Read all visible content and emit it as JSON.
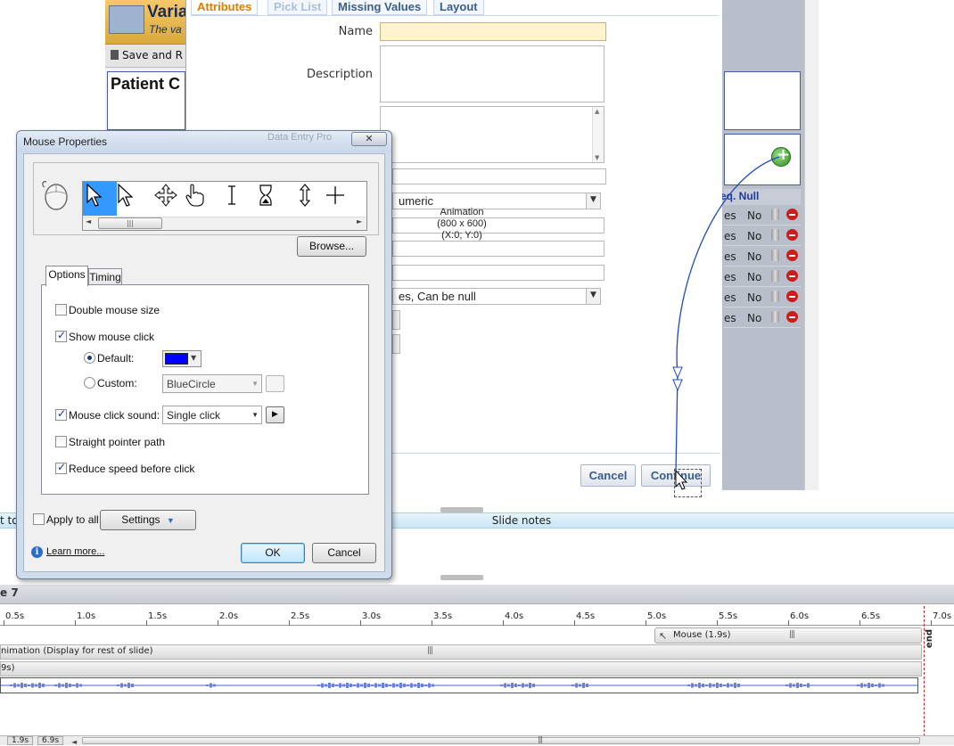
{
  "background_app": {
    "title": "Varia",
    "subtitle": "The va",
    "toolbar_save": "Save and R",
    "section_title": "Patient C",
    "right_table_header": "eq. Null",
    "rows": [
      {
        "a": "es",
        "b": "No"
      },
      {
        "a": "es",
        "b": "No"
      },
      {
        "a": "es",
        "b": "No"
      },
      {
        "a": "es",
        "b": "No"
      },
      {
        "a": "es",
        "b": "No"
      },
      {
        "a": "es",
        "b": "No"
      }
    ]
  },
  "variable_dialog": {
    "tabs": [
      "Attributes",
      "Pick List",
      "Missing Values",
      "Layout"
    ],
    "name_label": "Name",
    "name_value": "",
    "description_label": "Description",
    "description_value": "",
    "type_value": "umeric",
    "nullable_value": "es, Can be null",
    "animation_overlay": [
      "Animation",
      "(800 x 600)",
      "(X:0; Y:0)"
    ],
    "cancel_label": "Cancel",
    "continue_label": "Continue"
  },
  "mouse_properties": {
    "title": "Mouse Properties",
    "title_ghost": "Data Entry Pro",
    "close_glyph": "✕",
    "browse_label": "Browse...",
    "tabs": [
      "Options",
      "Timing"
    ],
    "options": {
      "double_mouse_size": {
        "label": "Double mouse size",
        "checked": false
      },
      "show_mouse_click": {
        "label": "Show mouse click",
        "checked": true
      },
      "default_label": "Default:",
      "default_selected": true,
      "default_color": "#0000ff",
      "custom_label": "Custom:",
      "custom_value": "BlueCircle",
      "mouse_click_sound": {
        "label": "Mouse click sound:",
        "checked": true
      },
      "sound_value": "Single click",
      "straight_pointer_path": {
        "label": "Straight pointer path",
        "checked": false
      },
      "reduce_speed": {
        "label": "Reduce speed before click",
        "checked": true
      }
    },
    "apply_to_all": {
      "label": "Apply to all",
      "checked": false
    },
    "settings_label": "Settings",
    "learn_more": "Learn more...",
    "ok_label": "OK",
    "cancel_label": "Cancel"
  },
  "slide_notes": {
    "title": "Slide notes",
    "left_text": "t to s"
  },
  "timeline": {
    "header_label": "e 7",
    "ticks": [
      "0.5s",
      "1.0s",
      "1.5s",
      "2.0s",
      "2.5s",
      "3.0s",
      "3.5s",
      "4.0s",
      "4.5s",
      "5.0s",
      "5.5s",
      "6.0s",
      "6.5s",
      "7.0s"
    ],
    "end_label": "end",
    "mouse_item": "Mouse (1.9s)",
    "animation_track": "nimation (Display for rest of slide)",
    "track2": "9s)",
    "bottom_items": [
      "1.9s",
      "6.9s"
    ]
  },
  "colors": {
    "accent_blue": "#3399ff",
    "path_blue": "#1f49c9",
    "tab_active": "#e07b00"
  }
}
